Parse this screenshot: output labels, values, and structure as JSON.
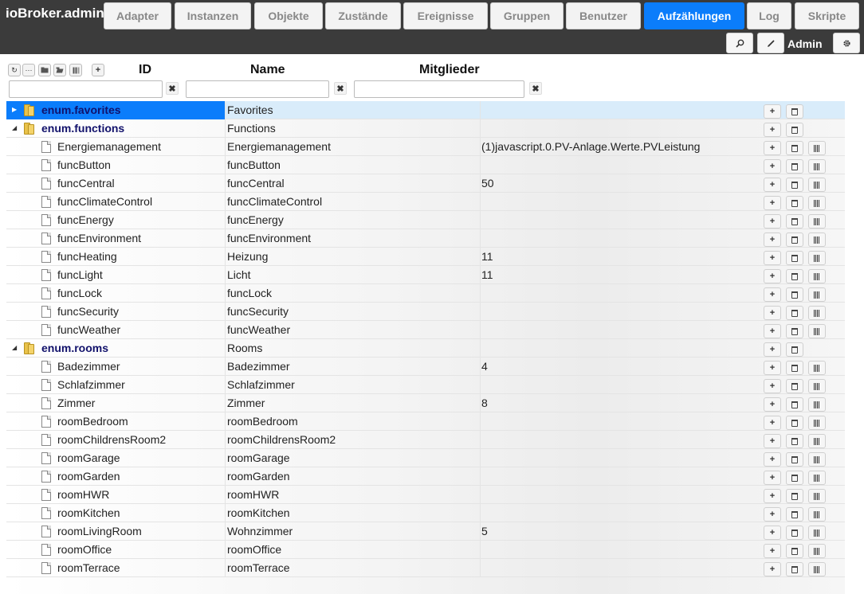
{
  "app": {
    "title": "ioBroker.admin"
  },
  "tabs": [
    {
      "label": "Adapter",
      "active": false
    },
    {
      "label": "Instanzen",
      "active": false
    },
    {
      "label": "Objekte",
      "active": false
    },
    {
      "label": "Zustände",
      "active": false
    },
    {
      "label": "Ereignisse",
      "active": false
    },
    {
      "label": "Gruppen",
      "active": false
    },
    {
      "label": "Benutzer",
      "active": false
    },
    {
      "label": "Aufzählungen",
      "active": true
    },
    {
      "label": "Log",
      "active": false
    },
    {
      "label": "Skripte",
      "active": false
    }
  ],
  "header": {
    "user": "Admin",
    "icons": [
      "search-icon",
      "pencil-icon",
      "gear-icon"
    ]
  },
  "columns": {
    "id": "ID",
    "name": "Name",
    "members": "Mitglieder"
  },
  "filters": {
    "id": "",
    "name": "",
    "members": ""
  },
  "colors": {
    "accent": "#0b7dfb",
    "topbar": "#3b3b3b",
    "enum_text": "#11116b",
    "selected_row": "#d9ecfa"
  },
  "rows": [
    {
      "id": "enum.favorites",
      "name": "Favorites",
      "members": "",
      "level": 0,
      "state": "collapsed",
      "selected": true
    },
    {
      "id": "enum.functions",
      "name": "Functions",
      "members": "",
      "level": 0,
      "state": "expanded",
      "selected": false
    },
    {
      "id": "Energiemanagement",
      "name": "Energiemanagement",
      "members": "(1)javascript.0.PV-Anlage.Werte.PVLeistung",
      "level": 1
    },
    {
      "id": "funcButton",
      "name": "funcButton",
      "members": "",
      "level": 1
    },
    {
      "id": "funcCentral",
      "name": "funcCentral",
      "members": "50",
      "level": 1
    },
    {
      "id": "funcClimateControl",
      "name": "funcClimateControl",
      "members": "",
      "level": 1
    },
    {
      "id": "funcEnergy",
      "name": "funcEnergy",
      "members": "",
      "level": 1
    },
    {
      "id": "funcEnvironment",
      "name": "funcEnvironment",
      "members": "",
      "level": 1
    },
    {
      "id": "funcHeating",
      "name": "Heizung",
      "members": "11",
      "level": 1
    },
    {
      "id": "funcLight",
      "name": "Licht",
      "members": "11",
      "level": 1
    },
    {
      "id": "funcLock",
      "name": "funcLock",
      "members": "",
      "level": 1
    },
    {
      "id": "funcSecurity",
      "name": "funcSecurity",
      "members": "",
      "level": 1
    },
    {
      "id": "funcWeather",
      "name": "funcWeather",
      "members": "",
      "level": 1
    },
    {
      "id": "enum.rooms",
      "name": "Rooms",
      "members": "",
      "level": 0,
      "state": "expanded",
      "selected": false
    },
    {
      "id": "Badezimmer",
      "name": "Badezimmer",
      "members": "4",
      "level": 1
    },
    {
      "id": "Schlafzimmer",
      "name": "Schlafzimmer",
      "members": "",
      "level": 1
    },
    {
      "id": "Zimmer",
      "name": "Zimmer",
      "members": "8",
      "level": 1
    },
    {
      "id": "roomBedroom",
      "name": "roomBedroom",
      "members": "",
      "level": 1
    },
    {
      "id": "roomChildrensRoom2",
      "name": "roomChildrensRoom2",
      "members": "",
      "level": 1
    },
    {
      "id": "roomGarage",
      "name": "roomGarage",
      "members": "",
      "level": 1
    },
    {
      "id": "roomGarden",
      "name": "roomGarden",
      "members": "",
      "level": 1
    },
    {
      "id": "roomHWR",
      "name": "roomHWR",
      "members": "",
      "level": 1
    },
    {
      "id": "roomKitchen",
      "name": "roomKitchen",
      "members": "",
      "level": 1
    },
    {
      "id": "roomLivingRoom",
      "name": "Wohnzimmer",
      "members": "5",
      "level": 1
    },
    {
      "id": "roomOffice",
      "name": "roomOffice",
      "members": "",
      "level": 1
    },
    {
      "id": "roomTerrace",
      "name": "roomTerrace",
      "members": "",
      "level": 1
    }
  ]
}
